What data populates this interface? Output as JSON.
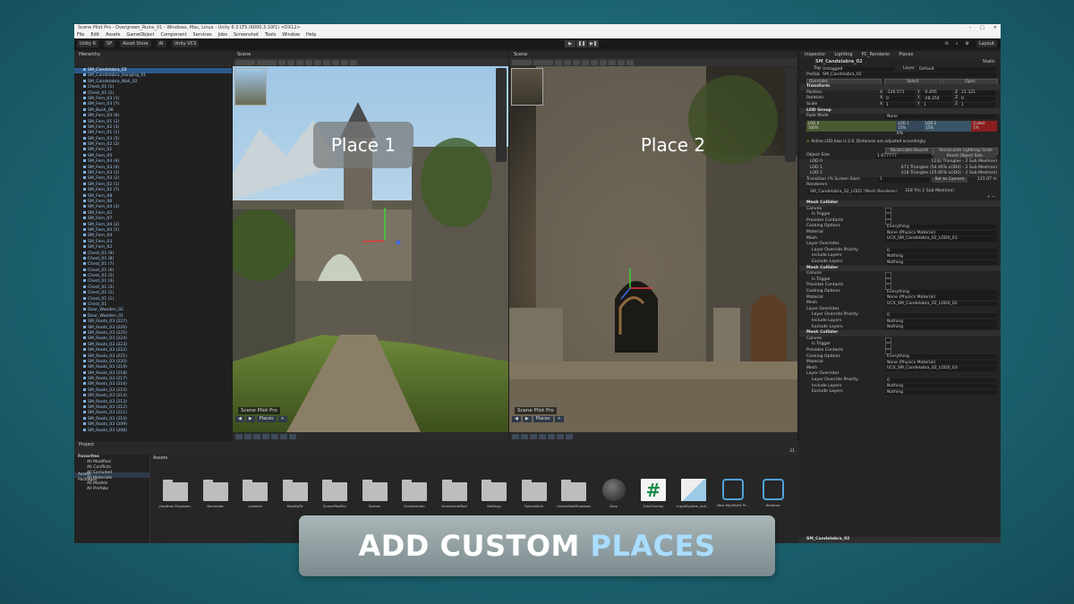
{
  "window": {
    "title": "Scene Pilot Pro - Overgrown_Ruins_01 - Windows, Mac, Linux - Unity 6.3 LTS (6000.3.10f1) <DX12>"
  },
  "menu": [
    "File",
    "Edit",
    "Assets",
    "GameObject",
    "Component",
    "Services",
    "Jobs",
    "Screenshot",
    "Tools",
    "Window",
    "Help"
  ],
  "toolbar": {
    "unity": "Unity 6",
    "sp": "SP",
    "store": "Asset Store",
    "ai": "AI",
    "vcs": "Unity VCS",
    "layout": "Layout"
  },
  "hierarchy": {
    "title": "Hierarchy",
    "items": [
      "SM_Candelabra_02",
      "SM_Candelabra_Hanging_01",
      "SM_Candelabra_Wall_02",
      "Chest_01 (1)",
      "Chest_01 (2)",
      "SM_Fern_03 (1)",
      "SM_Fern_03 (7)",
      "SM_Bush_08",
      "SM_Fern_03 (6)",
      "SM_Fern_01 (2)",
      "SM_Fern_02 (3)",
      "SM_Fern_01 (1)",
      "SM_Fern_03 (5)",
      "SM_Fern_02 (2)",
      "SM_Fern_01",
      "SM_Fern_05",
      "SM_Fern_04 (4)",
      "SM_Fern_03 (4)",
      "SM_Fern_03 (3)",
      "SM_Fern_03 (2)",
      "SM_Fern_02 (1)",
      "SM_Fern_02 (7)",
      "SM_Fern_08",
      "SM_Fern_06",
      "SM_Fern_04 (3)",
      "SM_Fern_02",
      "SM_Fern_07",
      "SM_Fern_04 (2)",
      "SM_Fern_04 (1)",
      "SM_Fern_04",
      "SM_Fern_03",
      "SM_Fern_02",
      "Chest_01 (9)",
      "Chest_01 (8)",
      "Chest_01 (7)",
      "Chest_01 (6)",
      "Chest_01 (5)",
      "Chest_01 (4)",
      "Chest_01 (3)",
      "Chest_01 (2)",
      "Chest_01 (1)",
      "Chest_01",
      "Door_Wooden_02",
      "Door_Wooden_01",
      "SM_Roots_03 (227)",
      "SM_Roots_03 (226)",
      "SM_Roots_03 (225)",
      "SM_Roots_03 (224)",
      "SM_Roots_03 (223)",
      "SM_Roots_03 (222)",
      "SM_Roots_03 (221)",
      "SM_Roots_03 (220)",
      "SM_Roots_03 (219)",
      "SM_Roots_03 (218)",
      "SM_Roots_03 (217)",
      "SM_Roots_03 (216)",
      "SM_Roots_03 (215)",
      "SM_Roots_03 (214)",
      "SM_Roots_03 (213)",
      "SM_Roots_03 (212)",
      "SM_Roots_03 (211)",
      "SM_Roots_03 (210)",
      "SM_Roots_03 (209)",
      "SM_Roots_03 (208)"
    ]
  },
  "scene_left": {
    "tab": "Scene",
    "place": "Place 1",
    "pilot": "Scene Pilot Pro",
    "places": "Places"
  },
  "scene_right": {
    "tab": "Scene",
    "place": "Place 2",
    "pilot": "Scene Pilot Pro",
    "places": "Places"
  },
  "inspector": {
    "tabs": [
      "Inspector",
      "Lighting",
      "PC_Renderer",
      "Places"
    ],
    "object_name": "SM_Candelabra_02",
    "static": "Static",
    "tag": "Untagged",
    "layer": "Default",
    "prefab": "SM_Candelabra_02",
    "overrides": "Overrides",
    "select": "Select",
    "open": "Open",
    "transform": {
      "title": "Transform",
      "position": "Position",
      "rotation": "Rotation",
      "scale": "Scale",
      "px": "-126.571",
      "py": "-0.495",
      "pz": "21.321",
      "rx": "0",
      "ry": "-28.254",
      "rz": "0",
      "sx": "1",
      "sy": "1",
      "sz": "1"
    },
    "lod_group": {
      "title": "LOD Group",
      "fade": "Fade Mode",
      "fade_val": "None",
      "lod0": "LOD 0",
      "lod0p": "100%",
      "lod1": "LOD 1",
      "lod1p": "25%",
      "lod2": "LOD 2",
      "lod2p": "15%",
      "culled": "Culled",
      "culledp": "1%",
      "pct": "6%",
      "warn": "Active LOD bias is 2.0. Distances are adjusted accordingly.",
      "recalc_bounds": "Recalculate Bounds",
      "recalc_lightmap": "Recalculate Lightmap Scale",
      "obj_size": "Object Size",
      "obj_size_val": "1.677777",
      "reset": "Reset Object Size",
      "row0": "LOD 0",
      "row0v": "1232 Triangles - 2 Sub Mesh(es)",
      "row1": "LOD 1",
      "row1v": "671 Triangles (54.46% LOD0) - 2 Sub Mesh(es)",
      "row2": "LOD 2",
      "row2v": "318 Triangles (25.85% LOD0) - 2 Sub Mesh(es)",
      "transition": "Transition (% Screen Size)",
      "transition_val": "1",
      "set_cam": "Set to Camera",
      "dist": "115.07 m",
      "renderers": "Renderers",
      "renderer_item": "SM_Candelabra_02_LOD2 (Mesh Renderer)",
      "renderer_info": "318 Tris 2 Sub Mesh(es)"
    },
    "colliders": [
      {
        "title": "Mesh Collider",
        "convex": "Convex",
        "trigger": "Is Trigger",
        "contacts": "Provides Contacts",
        "cooking": "Cooking Options",
        "cooking_val": "Everything",
        "material": "Material",
        "material_val": "None (Physics Material)",
        "mesh": "Mesh",
        "mesh_val": "UCX_SM_Candelabra_02_LOD0_01",
        "overrides": "Layer Overrides",
        "priority": "Layer Override Priority",
        "priority_val": "0",
        "include": "Include Layers",
        "include_val": "Nothing",
        "exclude": "Exclude Layers",
        "exclude_val": "Nothing"
      },
      {
        "title": "Mesh Collider",
        "convex": "Convex",
        "trigger": "Is Trigger",
        "contacts": "Provides Contacts",
        "cooking": "Cooking Options",
        "cooking_val": "Everything",
        "material": "Material",
        "material_val": "None (Physics Material)",
        "mesh": "Mesh",
        "mesh_val": "UCX_SM_Candelabra_02_LOD0_02",
        "overrides": "Layer Overrides",
        "priority": "Layer Override Priority",
        "priority_val": "0",
        "include": "Include Layers",
        "include_val": "Nothing",
        "exclude": "Exclude Layers",
        "exclude_val": "Nothing"
      },
      {
        "title": "Mesh Collider",
        "convex": "Convex",
        "trigger": "Is Trigger",
        "contacts": "Provides Contacts",
        "cooking": "Cooking Options",
        "cooking_val": "Everything",
        "material": "Material",
        "material_val": "None (Physics Material)",
        "mesh": "Mesh",
        "mesh_val": "UCX_SM_Candelabra_02_LOD0_03",
        "overrides": "Layer Overrides",
        "priority": "Layer Override Priority",
        "priority_val": "0",
        "include": "Include Layers",
        "include_val": "Nothing",
        "exclude": "Exclude Layers",
        "exclude_val": "Nothing"
      }
    ],
    "footer": "SM_Candelabra_02"
  },
  "project": {
    "title": "Project",
    "favorites": "Favorites",
    "fav_items": [
      "All Modified",
      "All Conflicts",
      "All Excluded",
      "All Materials",
      "All Models",
      "All Prefabs"
    ],
    "assets": "Assets",
    "packages": "Packages",
    "crumb": "Assets",
    "count": "21",
    "items": [
      "_Heathen Engineer...",
      "Decimate",
      "Lonkelal",
      "MyoMyFit",
      "ScenePilotPro",
      "Scenes",
      "Screenshots",
      "ScreenshotTool",
      "Settings",
      "TutorialInfo",
      "UnlitedSoftShadows",
      "Grey",
      "GridOverlay",
      "InputSystem_Acti...",
      "New MyoMyFit Pr...",
      "Readme"
    ]
  },
  "banner": {
    "white": "ADD CUSTOM ",
    "blue": "PLACES"
  }
}
